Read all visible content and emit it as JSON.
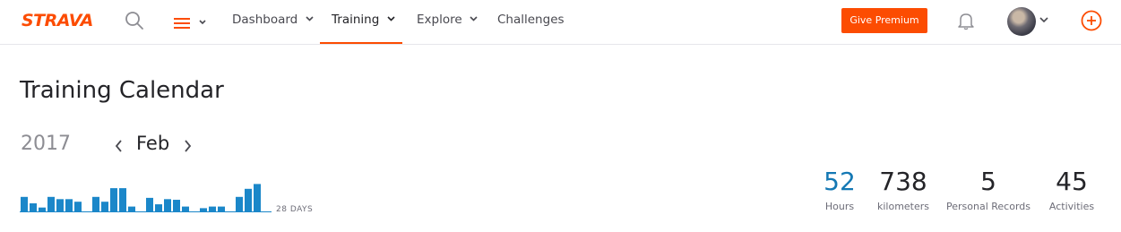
{
  "brand": {
    "logo_text": "STRAVA",
    "accent": "#fc4c02"
  },
  "nav": {
    "items": [
      {
        "label": "Dashboard",
        "dropdown": true
      },
      {
        "label": "Training",
        "dropdown": true,
        "active": true
      },
      {
        "label": "Explore",
        "dropdown": true
      },
      {
        "label": "Challenges",
        "dropdown": false
      }
    ],
    "premium_label": "Give Premium",
    "icons": [
      "search-icon",
      "hamburger-menu-icon",
      "bell-icon",
      "avatar",
      "add-circle-icon"
    ]
  },
  "page": {
    "title": "Training Calendar",
    "year": "2017",
    "month": "Feb",
    "days_label": "28 DAYS"
  },
  "chart_data": {
    "type": "bar",
    "color": "#1b87c9",
    "values": [
      0.45,
      0.25,
      0.12,
      0.45,
      0.38,
      0.38,
      0.3,
      0,
      0.45,
      0.3,
      0.72,
      0.72,
      0.15,
      0,
      0.42,
      0.22,
      0.38,
      0.36,
      0.15,
      0,
      0.1,
      0.15,
      0.15,
      0,
      0.45,
      0.7,
      0.85
    ]
  },
  "stats": [
    {
      "value": "52",
      "label": "Hours",
      "highlight": true
    },
    {
      "value": "738",
      "label": "kilometers",
      "highlight": false
    },
    {
      "value": "5",
      "label": "Personal Records",
      "highlight": false
    },
    {
      "value": "45",
      "label": "Activities",
      "highlight": false
    }
  ]
}
